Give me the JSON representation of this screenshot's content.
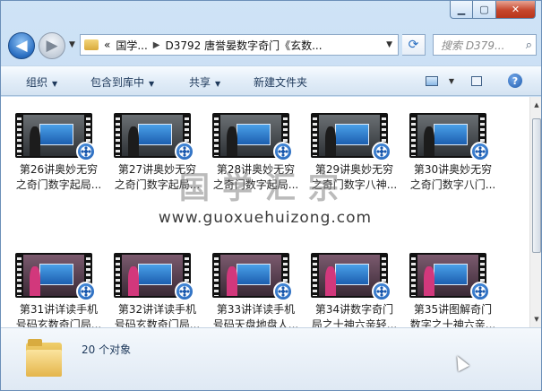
{
  "nav": {
    "back_glyph": "◀",
    "forward_glyph": "▶",
    "breadcrumb_prefix": "«",
    "breadcrumb": [
      "国学...",
      "D3792 唐誉晏数字奇门《玄数..."
    ],
    "search_placeholder": "搜索 D379..."
  },
  "toolbar": {
    "organize": "组织",
    "include_in_library": "包含到库中",
    "share": "共享",
    "new_folder": "新建文件夹"
  },
  "files": [
    {
      "label_line1": "第26讲奥妙无穷",
      "label_line2": "之奇门数字起局..."
    },
    {
      "label_line1": "第27讲奥妙无穷",
      "label_line2": "之奇门数字起局..."
    },
    {
      "label_line1": "第28讲奥妙无穷",
      "label_line2": "之奇门数字起局..."
    },
    {
      "label_line1": "第29讲奥妙无穷",
      "label_line2": "之奇门数字八神..."
    },
    {
      "label_line1": "第30讲奥妙无穷",
      "label_line2": "之奇门数字八门..."
    },
    {
      "label_line1": "第31讲详读手机",
      "label_line2": "号码玄数奇门局..."
    },
    {
      "label_line1": "第32讲详读手机",
      "label_line2": "号码玄数奇门局..."
    },
    {
      "label_line1": "第33讲详读手机",
      "label_line2": "号码天盘地盘人..."
    },
    {
      "label_line1": "第34讲数字奇门",
      "label_line2": "局之十神六亲轻..."
    },
    {
      "label_line1": "第35讲图解奇门",
      "label_line2": "数字之十神六亲..."
    }
  ],
  "watermark": {
    "chinese": "国学汇宗",
    "url": "www.guoxuehuizong.com"
  },
  "details": {
    "count_text": "20 个对象"
  }
}
